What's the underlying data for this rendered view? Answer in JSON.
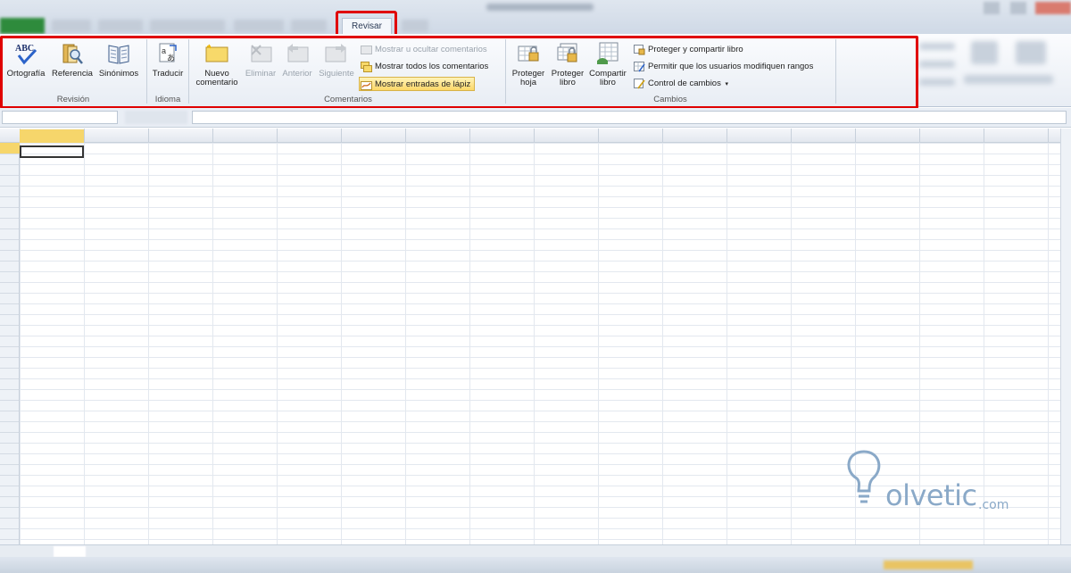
{
  "tabs": {
    "active": "Revisar"
  },
  "ribbon": {
    "revision": {
      "group_label": "Revisión",
      "ortografia": "Ortografía",
      "referencia": "Referencia",
      "sinonimos": "Sinónimos"
    },
    "idioma": {
      "group_label": "Idioma",
      "traducir": "Traducir"
    },
    "comentarios": {
      "group_label": "Comentarios",
      "nuevo_line1": "Nuevo",
      "nuevo_line2": "comentario",
      "eliminar": "Eliminar",
      "anterior": "Anterior",
      "siguiente": "Siguiente",
      "mostrar_ocultar": "Mostrar u ocultar comentarios",
      "mostrar_todos": "Mostrar todos los comentarios",
      "mostrar_lapiz": "Mostrar entradas de lápiz"
    },
    "cambios": {
      "group_label": "Cambios",
      "proteger_hoja_line1": "Proteger",
      "proteger_hoja_line2": "hoja",
      "proteger_libro_line1": "Proteger",
      "proteger_libro_line2": "libro",
      "compartir_line1": "Compartir",
      "compartir_line2": "libro",
      "proteger_compartir": "Proteger y compartir libro",
      "permitir_rangos": "Permitir que los usuarios modifiquen rangos",
      "control_cambios": "Control de cambios"
    }
  },
  "icons": {
    "spelling": "abc-check-icon",
    "research": "book-magnifier-icon",
    "thesaurus": "open-book-icon",
    "translate": "translate-icon",
    "new_comment": "new-comment-icon",
    "delete": "delete-comment-icon",
    "previous": "previous-comment-icon",
    "next": "next-comment-icon",
    "protect_sheet": "protect-sheet-icon",
    "protect_workbook": "protect-workbook-icon",
    "share_workbook": "share-workbook-icon"
  },
  "watermark": {
    "text": "olvetic",
    "suffix": ".com"
  },
  "colors": {
    "highlight": "#e00000",
    "selected_header": "#f6d66b",
    "active_button": "#fcd768"
  }
}
